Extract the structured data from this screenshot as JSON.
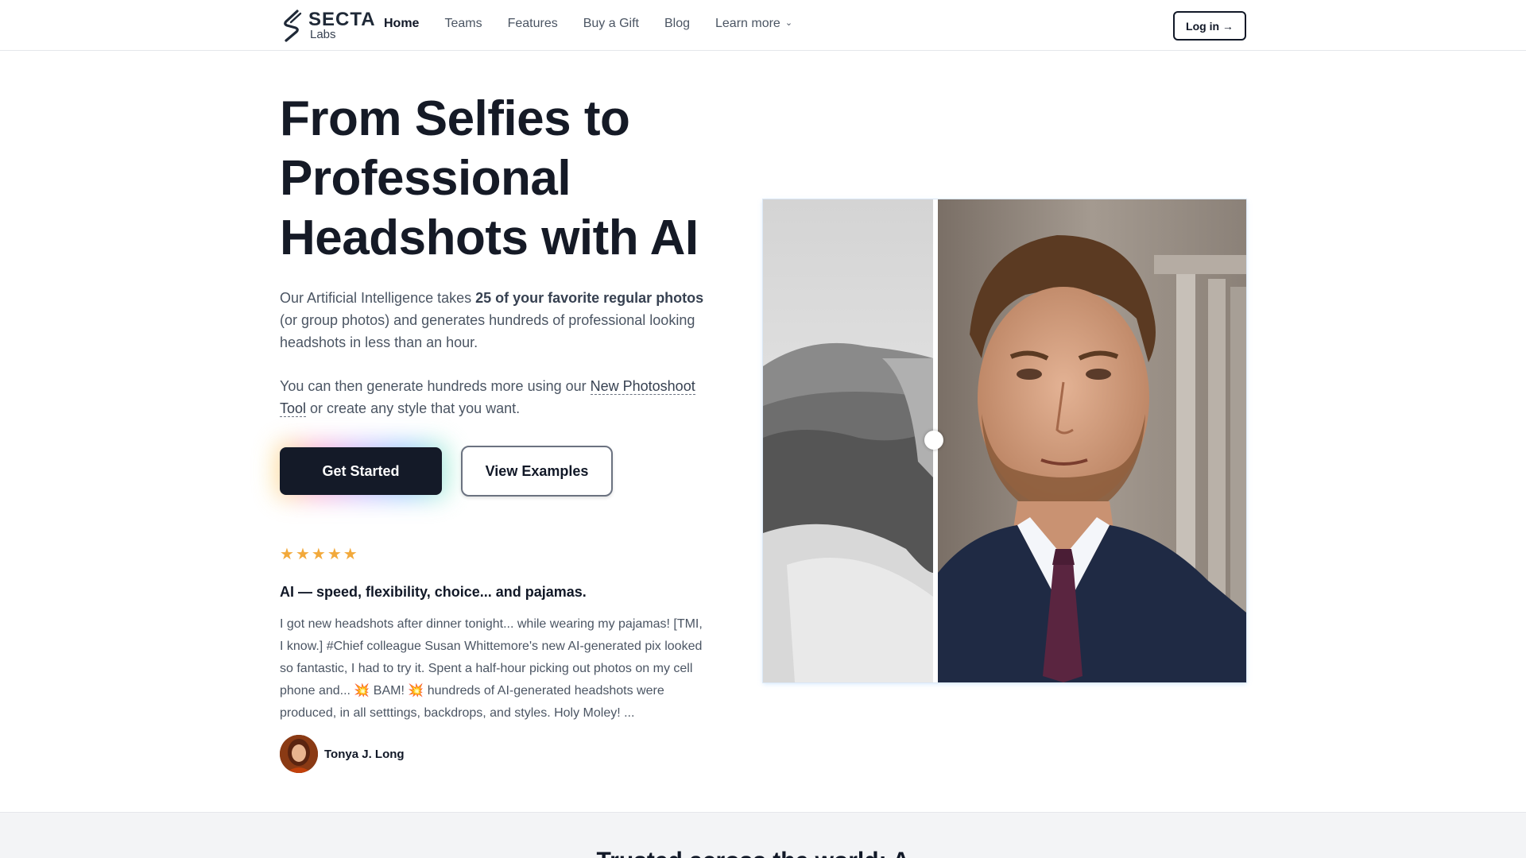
{
  "nav": {
    "logo_name": "SECTA",
    "logo_sub": "Labs",
    "links": [
      {
        "label": "Home",
        "active": true
      },
      {
        "label": "Teams"
      },
      {
        "label": "Features"
      },
      {
        "label": "Buy a Gift"
      },
      {
        "label": "Blog"
      },
      {
        "label": "Learn more",
        "icon": "chevron-down-icon"
      }
    ],
    "login": "Log in →"
  },
  "hero": {
    "headline_line1": "From Selfies to",
    "headline_line2": "Professional",
    "headline_line3": "Headshots with AI",
    "p1_a": "Our Artificial Intelligence takes ",
    "p1_bold": "25 of your favorite regular photos",
    "p1_b": " (or group photos) and generates hundreds of professional looking headshots in less than an hour.",
    "p2_a": "You can then generate hundreds more using our ",
    "p2_link": "New Photoshoot Tool",
    "p2_b": " or create any style that you want.",
    "cta_primary": "Get Started",
    "cta_secondary": "View Examples"
  },
  "review": {
    "rating": 5,
    "star_icon": "star-icon",
    "star_color": "#f2a93b",
    "title": "AI — speed, flexibility, choice... and pajamas.",
    "body_a": "I got new headshots after dinner tonight... while wearing my pajamas! [TMI, I know.] #Chief colleague Susan Whittemore's new AI-generated pix looked so fantastic, I had to try it. Spent a half-hour picking out photos on my cell phone and... ",
    "emoji1": "💥",
    "body_b": " BAM! ",
    "emoji2": "💥",
    "body_c": " hundreds of AI-generated headshots were produced, in all setttings, backdrops, and styles. Holy Moley! ...",
    "author": "Tonya J. Long"
  },
  "bottom": {
    "heading": "Trusted across the world: A..."
  },
  "colors": {
    "primary_button": "#141a28",
    "text_dark": "#111827",
    "text_muted": "#4b5563"
  }
}
